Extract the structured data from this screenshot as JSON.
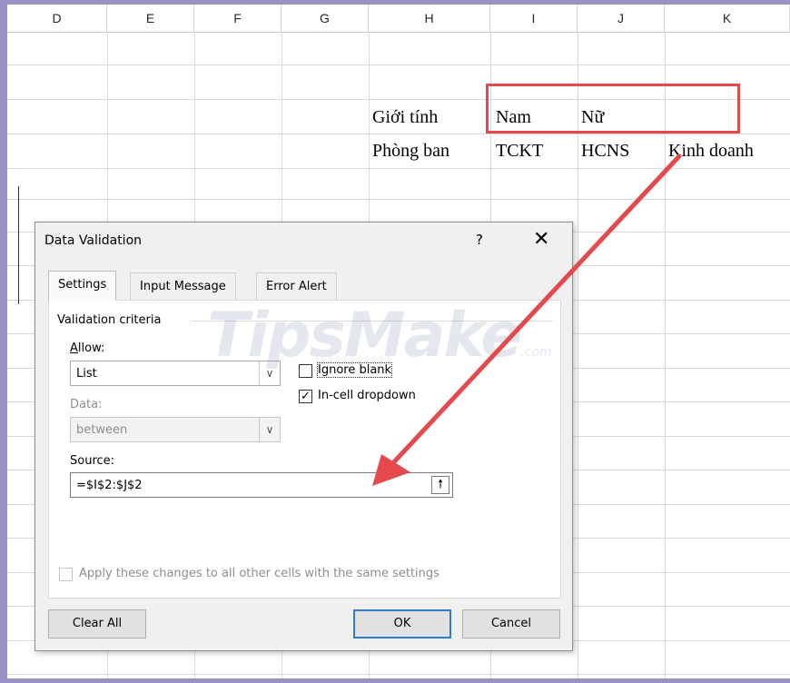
{
  "spreadsheet": {
    "columns": [
      "D",
      "E",
      "F",
      "G",
      "H",
      "I",
      "J",
      "K"
    ],
    "cells": {
      "h2": "Giới tính",
      "i2": "Nam",
      "j2": "Nữ",
      "h3": "Phòng ban",
      "i3": "TCKT",
      "j3": "HCNS",
      "k3": "Kinh doanh"
    }
  },
  "dialog": {
    "title": "Data Validation",
    "help": "?",
    "close": "✕",
    "tabs": [
      "Settings",
      "Input Message",
      "Error Alert"
    ],
    "active_tab": "Settings",
    "group_label": "Validation criteria",
    "allow_label": "Allow:",
    "allow_value": "List",
    "data_label": "Data:",
    "data_value": "between",
    "ignore_blank_label": "Ignore blank",
    "ignore_blank_checked": false,
    "in_cell_dropdown_label": "In-cell dropdown",
    "in_cell_dropdown_checked": true,
    "source_label": "Source:",
    "source_value": "=$I$2:$J$2",
    "apply_label": "Apply these changes to all other cells with the same settings",
    "buttons": {
      "clear_all": "Clear All",
      "ok": "OK",
      "cancel": "Cancel"
    }
  },
  "watermark": {
    "main": "TipsMake",
    "suffix": ".com"
  },
  "colors": {
    "highlight": "#e4494c",
    "frame": "#9b92c8",
    "accent": "#2f7ad3"
  },
  "icons": {
    "dropdown": "chevron-down-icon",
    "collapse": "collapse-dialog-icon",
    "check": "check-icon"
  }
}
